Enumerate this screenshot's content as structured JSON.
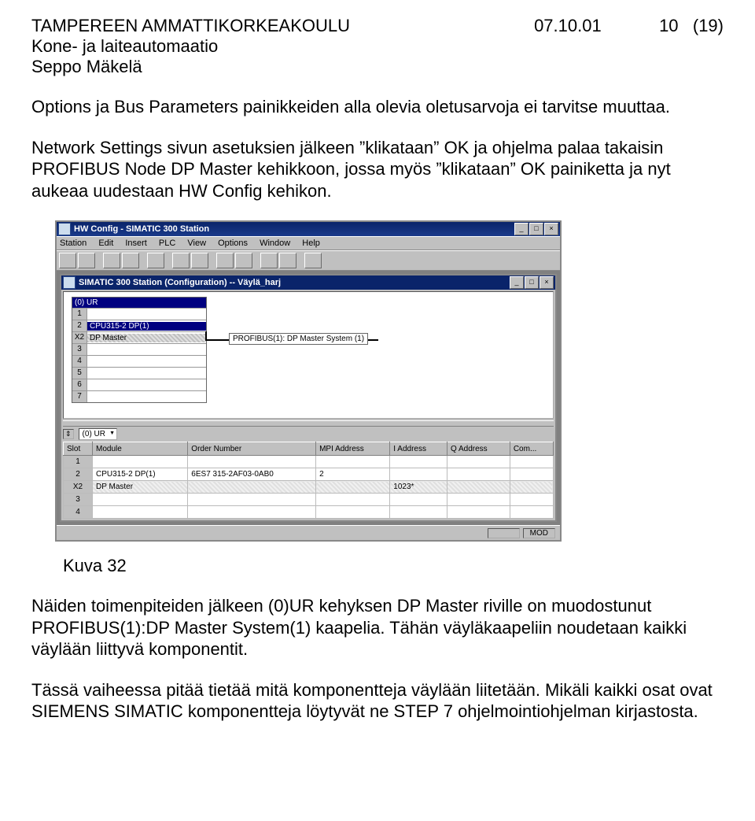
{
  "header": {
    "institution": "TAMPEREEN AMMATTIKORKEAKOULU",
    "date": "07.10.01",
    "page": "10   (19)",
    "dept": "Kone- ja laiteautomaatio",
    "author": "Seppo Mäkelä"
  },
  "para1": "Options ja Bus Parameters painikkeiden alla olevia  oletusarvoja ei tarvitse muuttaa.",
  "para2": "Network Settings sivun asetuksien jälkeen ”klikataan” OK ja ohjelma palaa takaisin PROFIBUS Node DP Master kehikkoon, jossa myös ”klikataan” OK painiketta ja nyt aukeaa uudestaan HW Config kehikon.",
  "screenshot": {
    "outer_title": "HW Config - SIMATIC 300 Station",
    "menus": [
      "Station",
      "Edit",
      "Insert",
      "PLC",
      "View",
      "Options",
      "Window",
      "Help"
    ],
    "ctrlbtns": [
      "_",
      "□",
      "×"
    ],
    "inner_title": "SIMATIC 300 Station (Configuration) -- Väylä_harj",
    "rack_title": "(0) UR",
    "rack_rows": [
      {
        "n": "1",
        "txt": ""
      },
      {
        "n": "2",
        "txt": "CPU315-2 DP(1)",
        "sel": true
      },
      {
        "n": "X2",
        "txt": "DP Master",
        "hatch": true
      },
      {
        "n": "3",
        "txt": ""
      },
      {
        "n": "4",
        "txt": ""
      },
      {
        "n": "5",
        "txt": ""
      },
      {
        "n": "6",
        "txt": ""
      },
      {
        "n": "7",
        "txt": ""
      }
    ],
    "bus_label": "PROFIBUS(1): DP Master System (1)",
    "combo_value": "(0)  UR",
    "columns": [
      "Slot",
      "Module",
      "Order Number",
      "MPI Address",
      "I Address",
      "Q Address",
      "Com..."
    ],
    "rows": [
      {
        "slot": "1",
        "module": "",
        "order": "",
        "mpi": "",
        "ia": "",
        "qa": "",
        "c": ""
      },
      {
        "slot": "2",
        "module": "CPU315-2 DP(1)",
        "order": "6ES7 315-2AF03-0AB0",
        "mpi": "2",
        "ia": "",
        "qa": "",
        "c": ""
      },
      {
        "slot": "X2",
        "module": "DP Master",
        "order": "",
        "mpi": "",
        "ia": "1023*",
        "qa": "",
        "c": "",
        "hatch": true
      },
      {
        "slot": "3",
        "module": "",
        "order": "",
        "mpi": "",
        "ia": "",
        "qa": "",
        "c": ""
      },
      {
        "slot": "4",
        "module": "",
        "order": "",
        "mpi": "",
        "ia": "",
        "qa": "",
        "c": ""
      }
    ],
    "status": "MOD"
  },
  "caption": "Kuva 32",
  "para3": "Näiden toimenpiteiden jälkeen  (0)UR kehyksen DP Master riville on muodostunut  PROFIBUS(1):DP Master System(1) kaapelia. Tähän väyläkaapeliin noudetaan kaikki väylään liittyvä komponentit.",
  "para4": "Tässä vaiheessa pitää   tietää mitä komponentteja väylään liitetään. Mikäli kaikki osat ovat SIEMENS SIMATIC komponentteja löytyvät ne STEP 7 ohjelmointiohjelman kirjastosta."
}
